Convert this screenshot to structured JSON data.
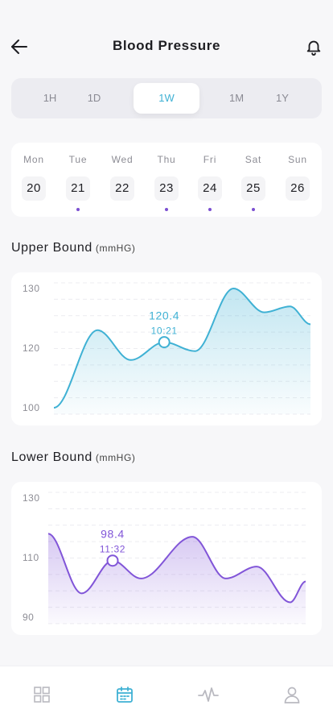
{
  "header": {
    "title": "Blood Pressure",
    "back_icon": "arrow-left-icon",
    "notification_icon": "bell-icon"
  },
  "range_tabs": [
    {
      "label": "1H",
      "active": false
    },
    {
      "label": "1D",
      "active": false
    },
    {
      "label": "1W",
      "active": true
    },
    {
      "label": "1M",
      "active": false
    },
    {
      "label": "1Y",
      "active": false
    }
  ],
  "week": [
    {
      "name": "Mon",
      "date": "20",
      "has_reading": false
    },
    {
      "name": "Tue",
      "date": "21",
      "has_reading": true
    },
    {
      "name": "Wed",
      "date": "22",
      "has_reading": false
    },
    {
      "name": "Thu",
      "date": "23",
      "has_reading": true
    },
    {
      "name": "Fri",
      "date": "24",
      "has_reading": true
    },
    {
      "name": "Sat",
      "date": "25",
      "has_reading": true
    },
    {
      "name": "Sun",
      "date": "26",
      "has_reading": false
    }
  ],
  "upper": {
    "title": "Upper Bound",
    "unit": "(mmHG)"
  },
  "lower": {
    "title": "Lower Bound",
    "unit": "(mmHG)"
  },
  "chart_data": [
    {
      "type": "area",
      "title": "Upper Bound",
      "ylabel": "(mmHG)",
      "yticks": [
        "130",
        "120",
        "100"
      ],
      "color": "#3fb1d4",
      "points": [
        {
          "x": 0.0,
          "y": 100
        },
        {
          "x": 0.17,
          "y": 123
        },
        {
          "x": 0.3,
          "y": 116
        },
        {
          "x": 0.43,
          "y": 121
        },
        {
          "x": 0.55,
          "y": 119
        },
        {
          "x": 0.7,
          "y": 130
        },
        {
          "x": 0.82,
          "y": 126
        },
        {
          "x": 0.92,
          "y": 127
        },
        {
          "x": 1.0,
          "y": 124
        }
      ],
      "highlight": {
        "x": 0.43,
        "y": 121,
        "value_label": "120.4",
        "time_label": "10:21"
      }
    },
    {
      "type": "area",
      "title": "Lower Bound",
      "ylabel": "(mmHG)",
      "yticks": [
        "130",
        "110",
        "90"
      ],
      "color": "#8155d8",
      "points": [
        {
          "x": 0.0,
          "y": 118
        },
        {
          "x": 0.13,
          "y": 98
        },
        {
          "x": 0.25,
          "y": 109
        },
        {
          "x": 0.36,
          "y": 103
        },
        {
          "x": 0.56,
          "y": 117
        },
        {
          "x": 0.69,
          "y": 103
        },
        {
          "x": 0.81,
          "y": 107
        },
        {
          "x": 0.94,
          "y": 95
        },
        {
          "x": 1.0,
          "y": 102
        }
      ],
      "highlight": {
        "x": 0.25,
        "y": 109,
        "value_label": "98.4",
        "time_label": "11:32"
      }
    }
  ],
  "tabbar": [
    {
      "icon": "grid-icon",
      "active": false
    },
    {
      "icon": "calendar-icon",
      "active": true
    },
    {
      "icon": "activity-icon",
      "active": false
    },
    {
      "icon": "profile-icon",
      "active": false
    }
  ],
  "colors": {
    "accent_blue": "#3fb1d4",
    "accent_purple": "#8155d8",
    "tab_inactive": "#b9b9c0"
  }
}
